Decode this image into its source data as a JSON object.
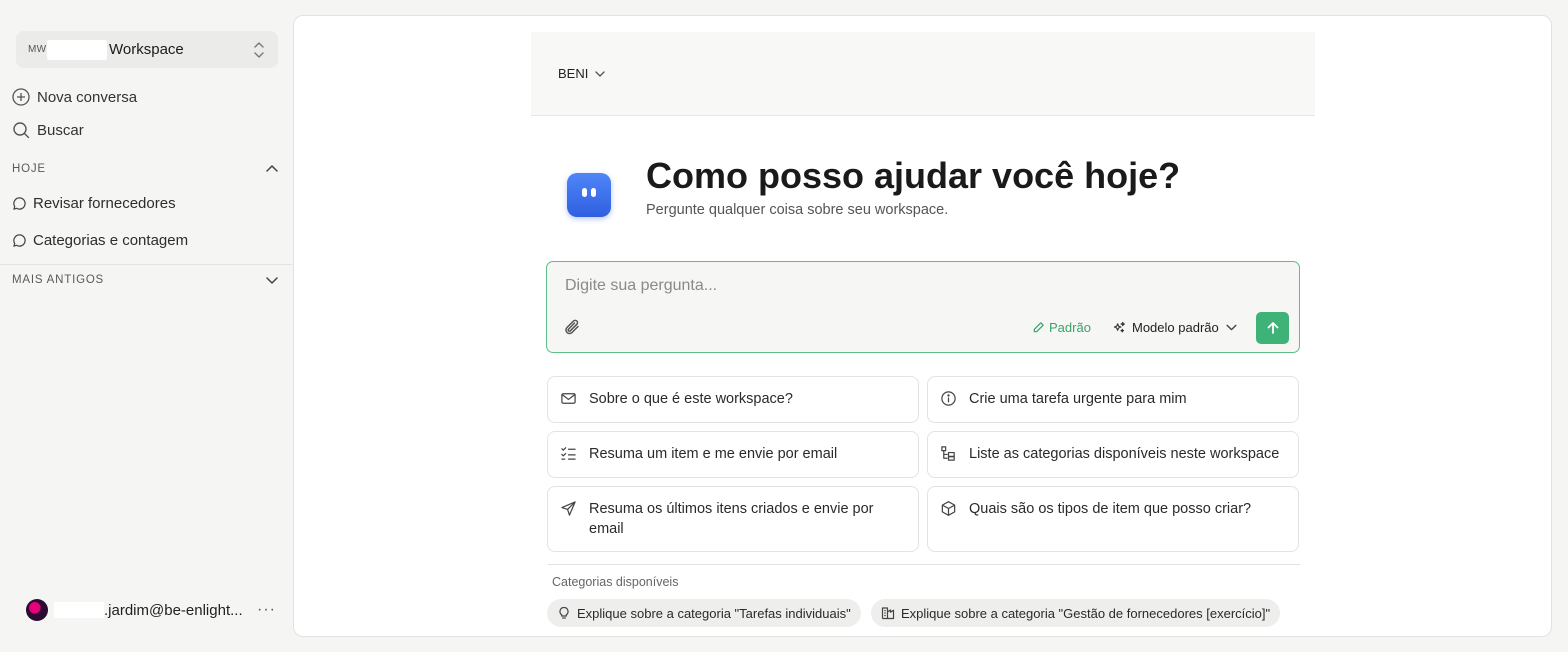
{
  "sidebar": {
    "workspace": {
      "abbr": "MW",
      "name": "Workspace"
    },
    "actions": {
      "new_chat": "Nova conversa",
      "search": "Buscar"
    },
    "section_today": "HOJE",
    "today_items": [
      "Revisar fornecedores",
      "Categorias e contagem"
    ],
    "section_older": "MAIS ANTIGOS",
    "user": {
      "email": ".jardim@be-enlight...",
      "more": "···"
    }
  },
  "header": {
    "agent_label": "BENI"
  },
  "hero": {
    "title": "Como posso ajudar você hoje?",
    "subtitle": "Pergunte qualquer coisa sobre seu workspace."
  },
  "composer": {
    "placeholder": "Digite sua pergunta...",
    "mode_label": "Padrão",
    "model_label": "Modelo padrão"
  },
  "suggestions": [
    {
      "icon": "mail-icon",
      "text": "Sobre o que é este workspace?"
    },
    {
      "icon": "info-icon",
      "text": "Crie uma tarefa urgente para mim"
    },
    {
      "icon": "checklist-icon",
      "text": "Resuma um item e me envie por email"
    },
    {
      "icon": "tree-list-icon",
      "text": "Liste as categorias disponíveis neste workspace"
    },
    {
      "icon": "send-icon",
      "text": "Resuma os últimos itens criados e envie por email"
    },
    {
      "icon": "box-icon",
      "text": "Quais são os tipos de item que posso criar?"
    }
  ],
  "categories": {
    "label": "Categorias disponíveis",
    "chips": [
      {
        "icon": "lightbulb-icon",
        "text": "Explique sobre a categoria \"Tarefas individuais\""
      },
      {
        "icon": "building-icon",
        "text": "Explique sobre a categoria \"Gestão de fornecedores [exercício]\""
      }
    ]
  },
  "colors": {
    "accent": "#3fb277",
    "bot_avatar": "#3d6ff0",
    "page_bg": "#f5f5f4"
  }
}
